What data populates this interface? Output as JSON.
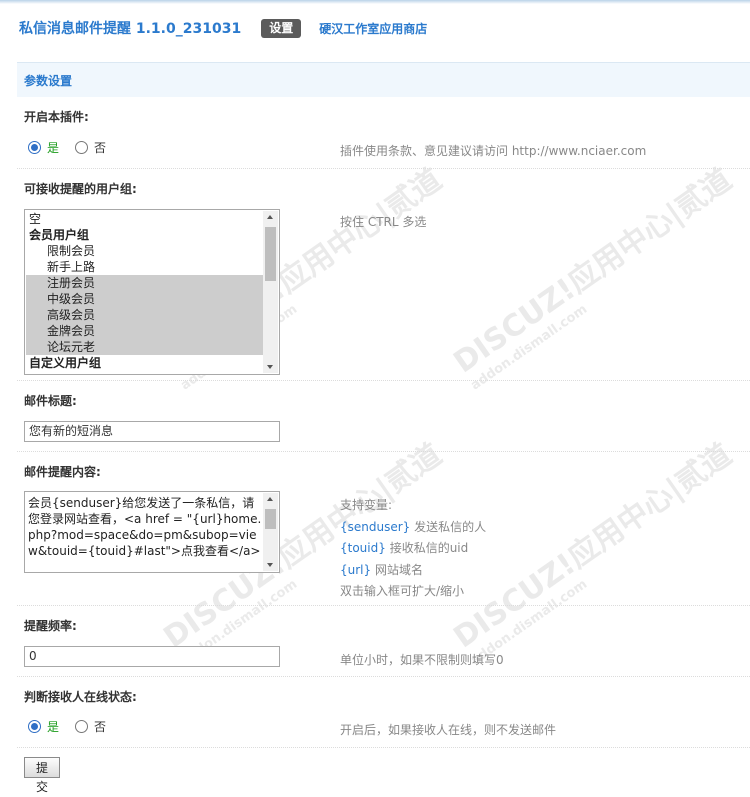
{
  "header": {
    "app_title": "私信消息邮件提醒 1.1.0_231031",
    "tab_settings": "设置",
    "store_link": "硬汉工作室应用商店"
  },
  "section": {
    "title": "参数设置"
  },
  "enable_plugin": {
    "label": "开启本插件:",
    "yes": "是",
    "no": "否",
    "selected": "是",
    "hint": "插件使用条款、意见建议请访问 http://www.nciaer.com"
  },
  "user_groups": {
    "label": "可接收提醒的用户组:",
    "hint": "按住 CTRL 多选",
    "options": [
      {
        "text": "空",
        "type": "option",
        "selected": false
      },
      {
        "text": "会员用户组",
        "type": "group",
        "selected": false
      },
      {
        "text": "限制会员",
        "type": "child",
        "selected": false
      },
      {
        "text": "新手上路",
        "type": "child",
        "selected": false
      },
      {
        "text": "注册会员",
        "type": "child",
        "selected": true
      },
      {
        "text": "中级会员",
        "type": "child",
        "selected": true
      },
      {
        "text": "高级会员",
        "type": "child",
        "selected": true
      },
      {
        "text": "金牌会员",
        "type": "child",
        "selected": true
      },
      {
        "text": "论坛元老",
        "type": "child",
        "selected": true
      },
      {
        "text": "自定义用户组",
        "type": "group",
        "selected": false
      }
    ]
  },
  "mail_subject": {
    "label": "邮件标题:",
    "value": "您有新的短消息"
  },
  "mail_content": {
    "label": "邮件提醒内容:",
    "value": "会员{senduser}给您发送了一条私信，请您登录网站查看，<a href = \"{url}home.php?mod=space&do=pm&subop=view&touid={touid}#last\">点我查看</a>",
    "vars_title": "支持变量:",
    "vars": [
      {
        "name": "{senduser}",
        "desc": " 发送私信的人"
      },
      {
        "name": "{touid}",
        "desc": " 接收私信的uid"
      },
      {
        "name": "{url}",
        "desc": " 网站域名"
      }
    ],
    "tip": "双击输入框可扩大/缩小"
  },
  "frequency": {
    "label": "提醒频率:",
    "value": "0",
    "hint": "单位小时，如果不限制则填写0"
  },
  "online_check": {
    "label": "判断接收人在线状态:",
    "yes": "是",
    "no": "否",
    "selected": "是",
    "hint": "开启后，如果接收人在线，则不发送邮件"
  },
  "submit_label": "提交",
  "watermark": {
    "text": "DISCUZ!应用中心|贰道",
    "domain": "addon.dismall.com"
  }
}
